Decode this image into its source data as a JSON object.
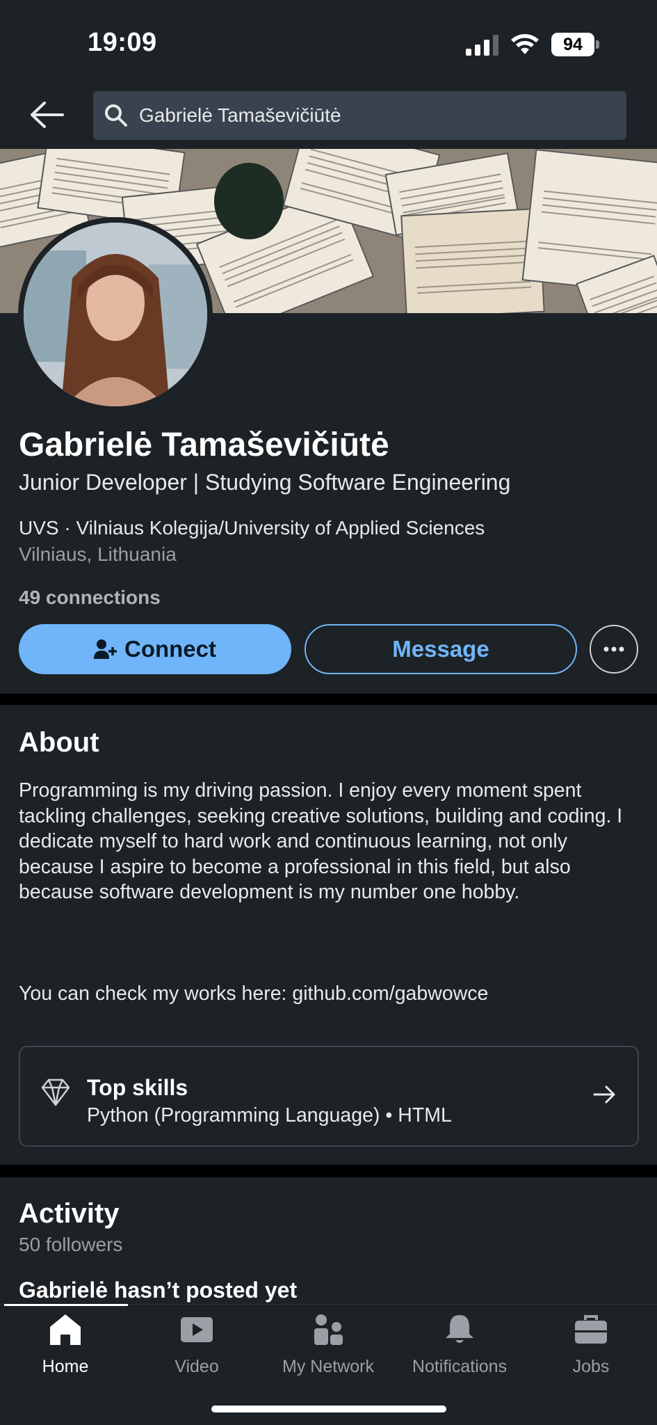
{
  "status_bar": {
    "time": "19:09",
    "battery": "94"
  },
  "search": {
    "query": "Gabrielė Tamaševičiūtė"
  },
  "profile": {
    "name": "Gabrielė Tamaševičiūtė",
    "headline": "Junior Developer | Studying Software Engineering",
    "school": "UVS · Vilniaus Kolegija/University of Applied Sciences",
    "location": "Vilniaus, Lithuania",
    "connections": "49 connections",
    "connect_label": "Connect",
    "message_label": "Message"
  },
  "about": {
    "title": "About",
    "text": "Programming is my driving passion. I enjoy every moment spent tackling challenges, seeking creative solutions, building and coding. I dedicate myself to hard work and continuous learning, not only because I aspire to become a professional in this field, but also because software development is my number one hobby.",
    "link_line": "You can check my works here: github.com/gabwowce"
  },
  "skills": {
    "title": "Top skills",
    "list": "Python (Programming Language) • HTML"
  },
  "activity": {
    "title": "Activity",
    "followers": "50 followers",
    "empty_message": "Gabrielė hasn’t posted yet"
  },
  "bottom_nav": [
    {
      "label": "Home",
      "icon": "home-icon",
      "active": true
    },
    {
      "label": "Video",
      "icon": "video-icon",
      "active": false
    },
    {
      "label": "My Network",
      "icon": "network-icon",
      "active": false
    },
    {
      "label": "Notifications",
      "icon": "bell-icon",
      "active": false
    },
    {
      "label": "Jobs",
      "icon": "briefcase-icon",
      "active": false
    }
  ],
  "colors": {
    "background": "#1d2226",
    "accent": "#70b5f9",
    "search_bg": "#38434f"
  }
}
